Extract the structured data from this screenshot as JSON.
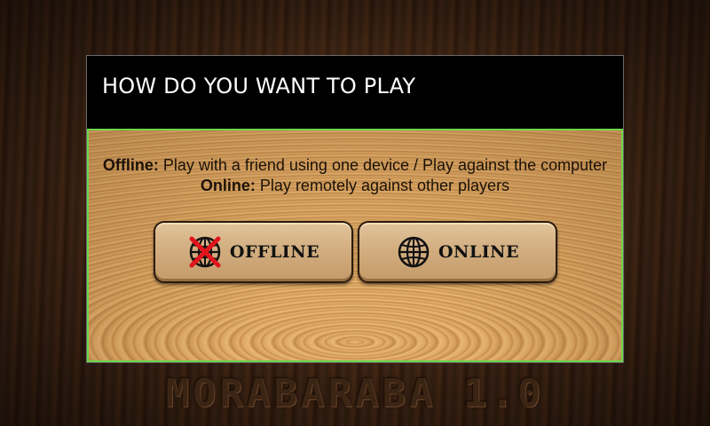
{
  "dialog": {
    "title": "HOW DO YOU WANT TO PLAY",
    "offline_term": "Offline:",
    "offline_desc": " Play with a friend using one device / Play against the computer",
    "online_term": "Online:",
    "online_desc": " Play remotely against other players",
    "buttons": {
      "offline": {
        "label": "OFFLINE",
        "icon": "globe-crossed-icon"
      },
      "online": {
        "label": "ONLINE",
        "icon": "globe-icon"
      }
    }
  },
  "game": {
    "title": "MORABARABA 1.0"
  },
  "colors": {
    "dialog_header": "#000000",
    "dialog_border": "#6fd64a",
    "title_text": "#ffffff",
    "cross": "#e0141c"
  }
}
